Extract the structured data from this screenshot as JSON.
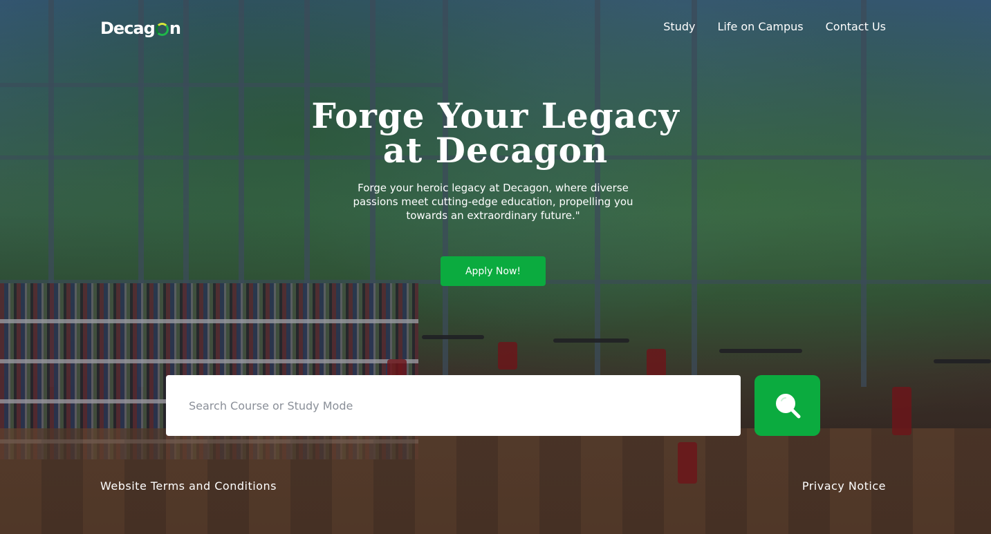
{
  "brand": {
    "logo_text_before": "Decag",
    "logo_text_after": "n",
    "accent_color": "#0bab3f"
  },
  "nav": {
    "items": [
      {
        "label": "Study"
      },
      {
        "label": "Life on Campus"
      },
      {
        "label": "Contact Us"
      }
    ]
  },
  "hero": {
    "title_line1": "Forge Your Legacy",
    "title_line2": "at Decagon",
    "subtitle": "Forge your heroic legacy at Decagon, where diverse passions meet cutting-edge education, propelling you towards an extraordinary future.\"",
    "apply_label": "Apply Now!"
  },
  "search": {
    "placeholder": "Search Course or Study Mode",
    "value": "",
    "button_icon": "search-icon"
  },
  "footer": {
    "terms_label": "Website Terms and Conditions",
    "privacy_label": "Privacy Notice"
  }
}
